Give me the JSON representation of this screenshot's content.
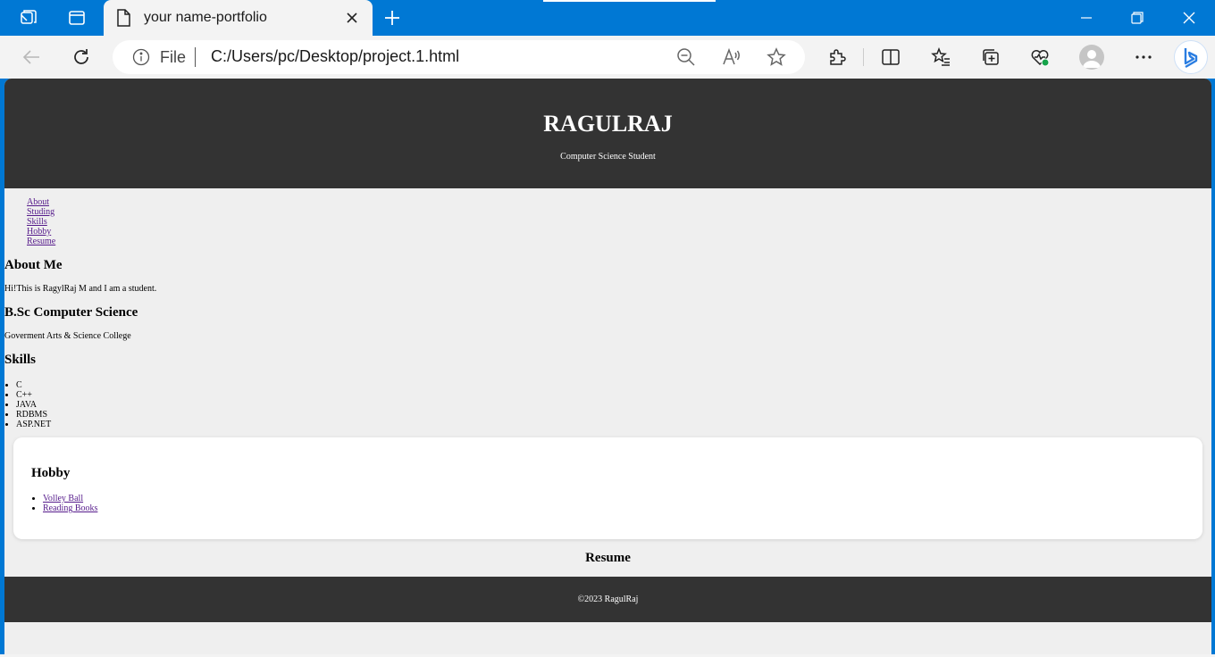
{
  "browser": {
    "tab_title": "your name-portfolio",
    "address": {
      "scheme_label": "File",
      "url": "C:/Users/pc/Desktop/project.1.html"
    }
  },
  "header": {
    "name": "RAGULRAJ",
    "tagline": "Computer Science Student"
  },
  "nav": {
    "items": [
      {
        "label": "About"
      },
      {
        "label": "Studing"
      },
      {
        "label": "Skills"
      },
      {
        "label": "Hobby"
      },
      {
        "label": "Resume"
      }
    ]
  },
  "about": {
    "heading": "About Me",
    "text": "Hi!This is RagylRaj M and I am a student."
  },
  "study": {
    "heading": "B.Sc Computer Science",
    "text": "Goverment Arts & Science College"
  },
  "skills": {
    "heading": "Skills",
    "items": [
      "C",
      "C++",
      "JAVA",
      "RDBMS",
      "ASP.NET"
    ]
  },
  "hobby": {
    "heading": "Hobby",
    "items": [
      "Volley Ball",
      "Reading Books"
    ]
  },
  "resume": {
    "heading": "Resume"
  },
  "footer": {
    "text": "©2023 RagulRaj"
  },
  "colors": {
    "titlebar": "#0078d4",
    "browser_chrome": "#f3f3f3",
    "page_background": "#efefef",
    "header_footer_bg": "#333333",
    "link_visited": "#551a8b"
  }
}
